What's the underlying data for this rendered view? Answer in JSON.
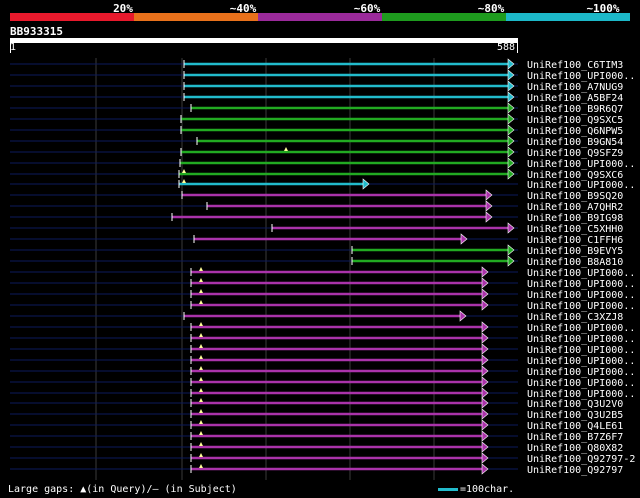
{
  "legend": {
    "labels": [
      "20%",
      "~40%",
      "~60%",
      "~80%",
      "~100%"
    ],
    "colors": [
      "#e8192c",
      "#e8711b",
      "#9b2a9b",
      "#1e9b1e",
      "#1cb8c8"
    ]
  },
  "query": {
    "name": "BB933315",
    "start": "1",
    "end": "588"
  },
  "hits": [
    {
      "label": "UniRef100_C6TIM3",
      "color": "#22bbcc"
    },
    {
      "label": "UniRef100_UPI000..",
      "color": "#22bbcc"
    },
    {
      "label": "UniRef100_A7NUG9",
      "color": "#22bbcc"
    },
    {
      "label": "UniRef100_A5BF24",
      "color": "#22bbcc"
    },
    {
      "label": "UniRef100_B9R6Q7",
      "color": "#22aa22"
    },
    {
      "label": "UniRef100_Q9SXC5",
      "color": "#22aa22"
    },
    {
      "label": "UniRef100_Q6NPW5",
      "color": "#22aa22"
    },
    {
      "label": "UniRef100_B9GN54",
      "color": "#22aa22"
    },
    {
      "label": "UniRef100_Q9SFZ9",
      "color": "#22aa22"
    },
    {
      "label": "UniRef100_UPI000..",
      "color": "#22aa22"
    },
    {
      "label": "UniRef100_Q9SXC6",
      "color": "#22aa22"
    },
    {
      "label": "UniRef100_UPI000..",
      "color": "#22bbcc"
    },
    {
      "label": "UniRef100_B9SQ20",
      "color": "#aa33aa"
    },
    {
      "label": "UniRef100_A7QHR2",
      "color": "#aa33aa"
    },
    {
      "label": "UniRef100_B9IG98",
      "color": "#aa33aa"
    },
    {
      "label": "UniRef100_C5XHH0",
      "color": "#aa33aa"
    },
    {
      "label": "UniRef100_C1FFH6",
      "color": "#aa33aa"
    },
    {
      "label": "UniRef100_B9EVY5",
      "color": "#22aa22"
    },
    {
      "label": "UniRef100_B8A810",
      "color": "#22aa22"
    },
    {
      "label": "UniRef100_UPI000..",
      "color": "#aa33aa"
    },
    {
      "label": "UniRef100_UPI000..",
      "color": "#aa33aa"
    },
    {
      "label": "UniRef100_UPI000..",
      "color": "#aa33aa"
    },
    {
      "label": "UniRef100_UPI000..",
      "color": "#aa33aa"
    },
    {
      "label": "UniRef100_C3XZJ8",
      "color": "#aa33aa"
    },
    {
      "label": "UniRef100_UPI000..",
      "color": "#aa33aa"
    },
    {
      "label": "UniRef100_UPI000..",
      "color": "#aa33aa"
    },
    {
      "label": "UniRef100_UPI000..",
      "color": "#aa33aa"
    },
    {
      "label": "UniRef100_UPI000..",
      "color": "#aa33aa"
    },
    {
      "label": "UniRef100_UPI000..",
      "color": "#aa33aa"
    },
    {
      "label": "UniRef100_UPI000..",
      "color": "#aa33aa"
    },
    {
      "label": "UniRef100_UPI000..",
      "color": "#aa33aa"
    },
    {
      "label": "UniRef100_Q3U2V0",
      "color": "#aa33aa"
    },
    {
      "label": "UniRef100_Q3U2B5",
      "color": "#aa33aa"
    },
    {
      "label": "UniRef100_Q4LE61",
      "color": "#aa33aa"
    },
    {
      "label": "UniRef100_B7Z6F7",
      "color": "#aa33aa"
    },
    {
      "label": "UniRef100_Q80X82",
      "color": "#aa33aa"
    },
    {
      "label": "UniRef100_Q92797-2",
      "color": "#aa33aa"
    },
    {
      "label": "UniRef100_Q92797",
      "color": "#aa33aa"
    }
  ],
  "footer": {
    "gaps_text": "Large gaps: ▲(in Query)/– (in Subject)",
    "scale_text": "=100char."
  }
}
